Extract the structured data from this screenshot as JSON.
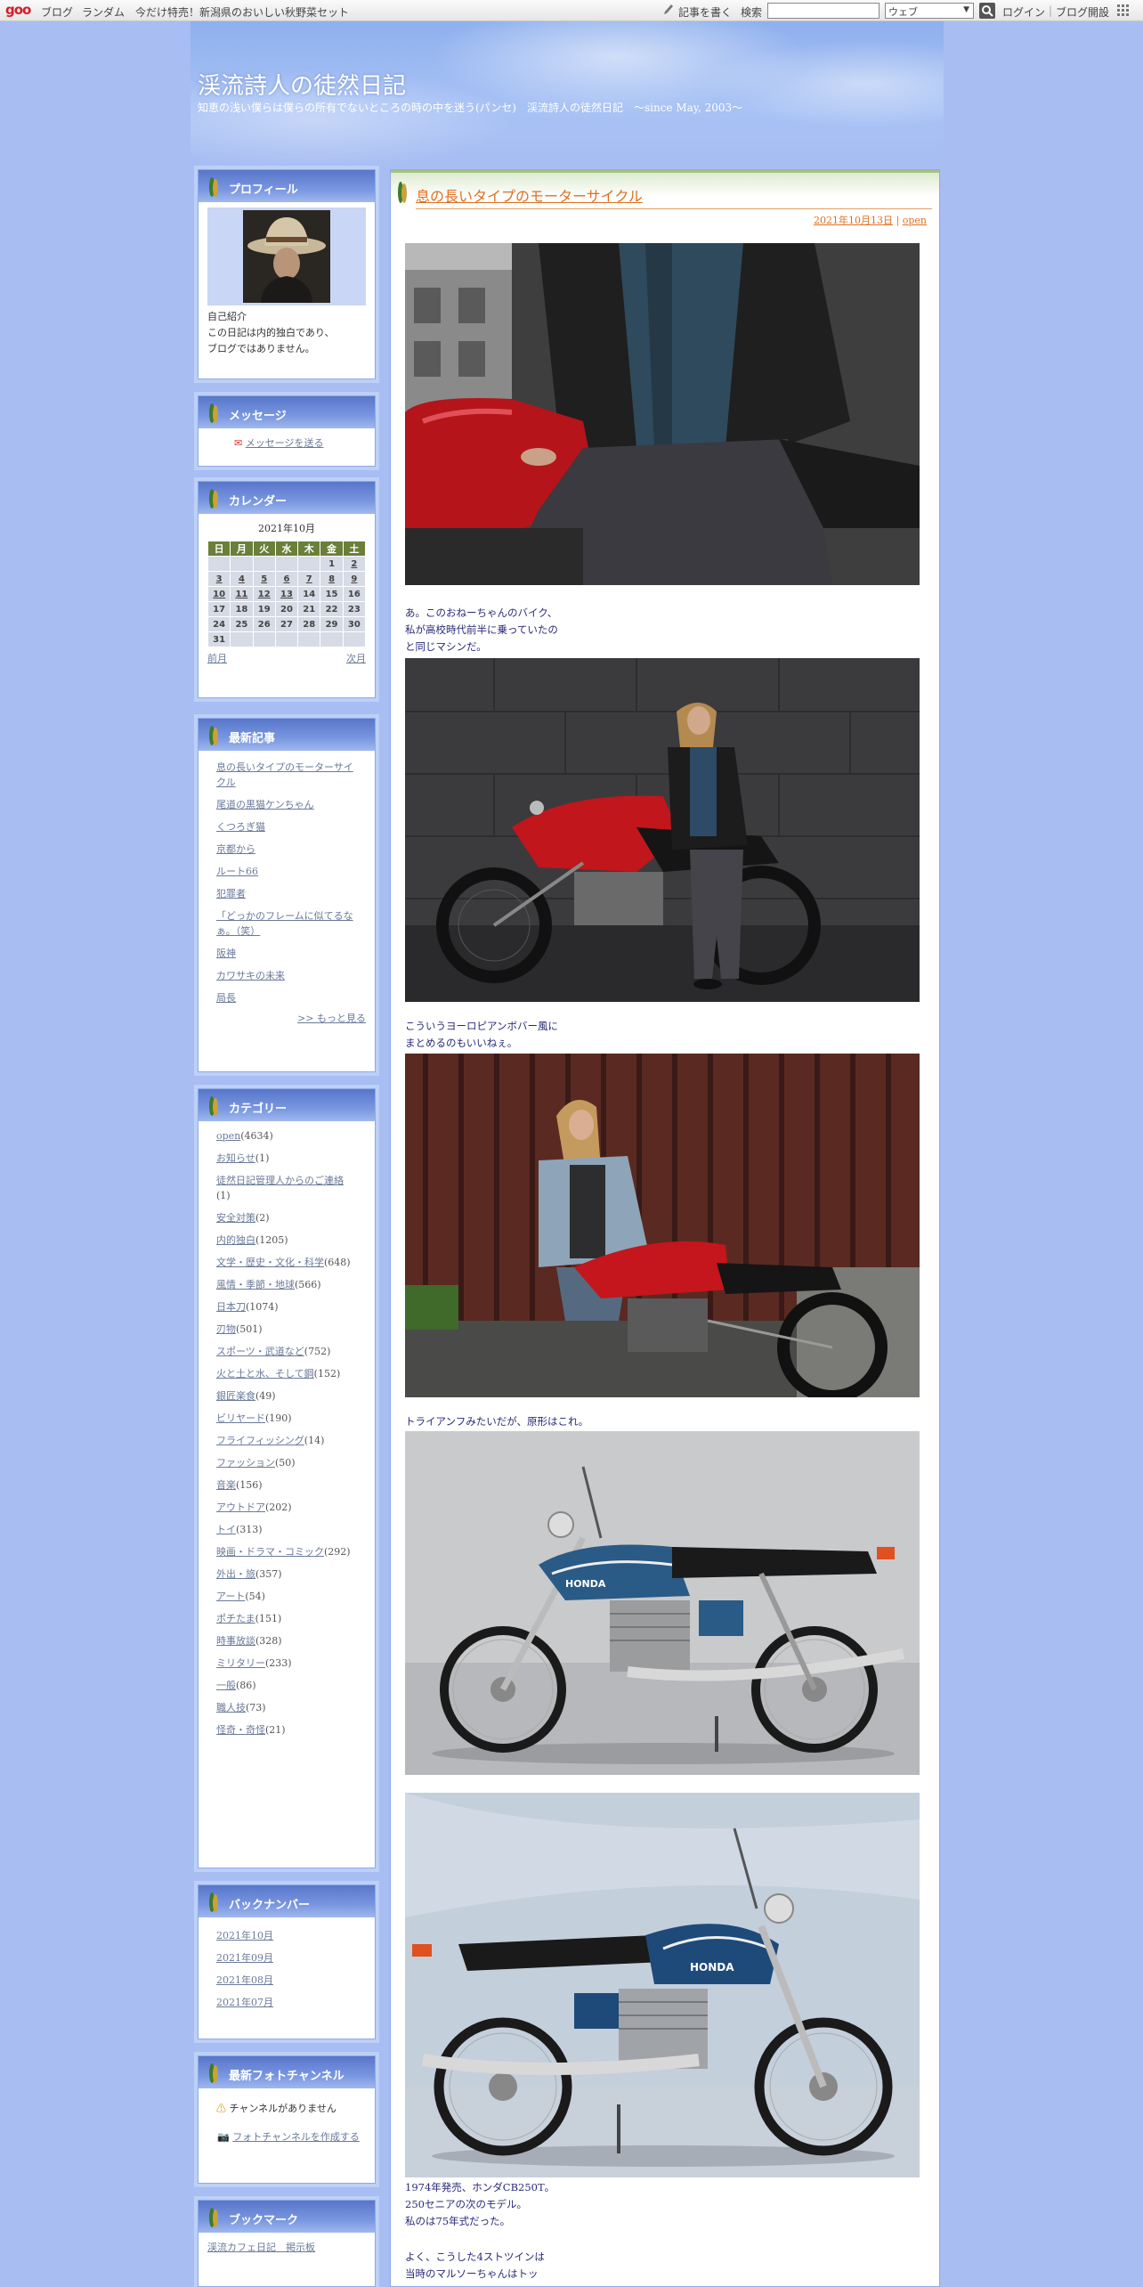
{
  "toolbar": {
    "logo": "goo",
    "links": [
      "ブログ",
      "ランダム",
      "今だけ特売！新潟県のおいしい秋野菜セット"
    ],
    "write": "記事を書く",
    "search_label": "検索",
    "search_value": "",
    "search_scope": "ウェブ",
    "login": "ログイン",
    "open_blog": "ブログ開設"
  },
  "header": {
    "title": "渓流詩人の徒然日記",
    "subtitle": "知恵の浅い僕らは僕らの所有でないところの時の中を迷う(パンセ)　渓流詩人の徒然日記　～since May, 2003～"
  },
  "profile": {
    "heading": "プロフィール",
    "intro_label": "自己紹介",
    "intro_lines": [
      "この日記は内的独白であり、",
      "ブログではありません。"
    ]
  },
  "message": {
    "heading": "メッセージ",
    "link": "メッセージを送る"
  },
  "calendar": {
    "heading": "カレンダー",
    "month": "2021年10月",
    "weekdays": [
      "日",
      "月",
      "火",
      "水",
      "木",
      "金",
      "土"
    ],
    "weeks": [
      [
        "",
        "",
        "",
        "",
        "",
        "1",
        "2"
      ],
      [
        "3",
        "4",
        "5",
        "6",
        "7",
        "8",
        "9"
      ],
      [
        "10",
        "11",
        "12",
        "13",
        "14",
        "15",
        "16"
      ],
      [
        "17",
        "18",
        "19",
        "20",
        "21",
        "22",
        "23"
      ],
      [
        "24",
        "25",
        "26",
        "27",
        "28",
        "29",
        "30"
      ],
      [
        "31",
        "",
        "",
        "",
        "",
        "",
        ""
      ]
    ],
    "linked_days": [
      "2",
      "3",
      "4",
      "5",
      "6",
      "7",
      "8",
      "9",
      "10",
      "11",
      "12",
      "13"
    ],
    "prev": "前月",
    "next": "次月"
  },
  "recent": {
    "heading": "最新記事",
    "items": [
      "息の長いタイプのモーターサイクル",
      "尾道の黒猫ケンちゃん",
      "くつろぎ猫",
      "京都から",
      "ルート66",
      "犯罪者",
      "「どっかのフレームに似てるなぁ。（笑）",
      "阪神",
      "カワサキの未来",
      "局長"
    ],
    "more": ">> もっと見る"
  },
  "categories": {
    "heading": "カテゴリー",
    "items": [
      {
        "name": "open",
        "count": "(4634)"
      },
      {
        "name": "お知らせ",
        "count": "(1)"
      },
      {
        "name": "徒然日記管理人からのご連絡",
        "count": "(1)"
      },
      {
        "name": "安全対策",
        "count": "(2)"
      },
      {
        "name": "内的独白",
        "count": "(1205)"
      },
      {
        "name": "文学・歴史・文化・科学",
        "count": "(648)"
      },
      {
        "name": "風情・季節・地球",
        "count": "(566)"
      },
      {
        "name": "日本刀",
        "count": "(1074)"
      },
      {
        "name": "刃物",
        "count": "(501)"
      },
      {
        "name": "スポーツ・武道など",
        "count": "(752)"
      },
      {
        "name": "火と土と水、そして鋼",
        "count": "(152)"
      },
      {
        "name": "銀匠楽食",
        "count": "(49)"
      },
      {
        "name": "ビリヤード",
        "count": "(190)"
      },
      {
        "name": "フライフィッシング",
        "count": "(14)"
      },
      {
        "name": "ファッション",
        "count": "(50)"
      },
      {
        "name": "音楽",
        "count": "(156)"
      },
      {
        "name": "アウトドア",
        "count": "(202)"
      },
      {
        "name": "トイ",
        "count": "(313)"
      },
      {
        "name": "映画・ドラマ・コミック",
        "count": "(292)"
      },
      {
        "name": "外出・旅",
        "count": "(357)"
      },
      {
        "name": "アート",
        "count": "(54)"
      },
      {
        "name": "ポチたま",
        "count": "(151)"
      },
      {
        "name": "時事放談",
        "count": "(328)"
      },
      {
        "name": "ミリタリー",
        "count": "(233)"
      },
      {
        "name": "一般",
        "count": "(86)"
      },
      {
        "name": "職人技",
        "count": "(73)"
      },
      {
        "name": "怪奇・奇怪",
        "count": "(21)"
      }
    ]
  },
  "backnumber": {
    "heading": "バックナンバー",
    "items": [
      "2021年10月",
      "2021年09月",
      "2021年08月",
      "2021年07月"
    ]
  },
  "photochannel": {
    "heading": "最新フォトチャンネル",
    "none": "チャンネルがありません",
    "create": "フォトチャンネルを作成する"
  },
  "bookmark": {
    "heading": "ブックマーク",
    "items": [
      "渓流カフェ日記　掲示板"
    ]
  },
  "post": {
    "title": "息の長いタイプのモーターサイクル",
    "date": "2021年10月13日",
    "sep": " | ",
    "category": "open",
    "text1": "あ。このおねーちゃんのバイク、\n私が高校時代前半に乗っていたの\nと同じマシンだ。",
    "text2": "こういうヨーロピアンボバー風に\nまとめるのもいいねぇ。",
    "text3": "トライアンフみたいだが、原形はこれ。",
    "text4": "1974年発売、ホンダCB250T。\n250セニアの次のモデル。\n私のは75年式だった。",
    "text5": "よく、こうした4ストツインは\n当時のマルソーちゃんはトッ",
    "tank_badge": "HONDA"
  }
}
